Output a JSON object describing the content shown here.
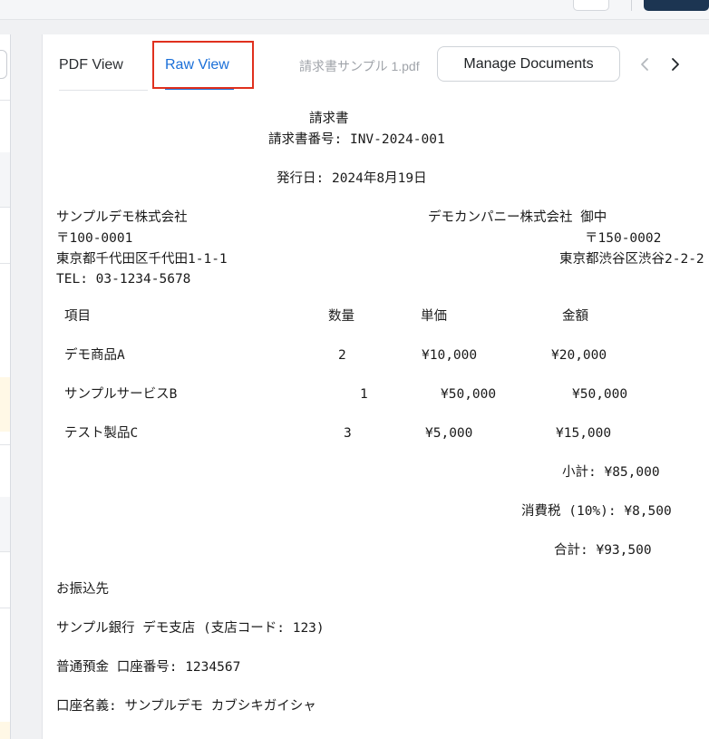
{
  "tabs": {
    "pdf_view": "PDF View",
    "raw_view": "Raw View"
  },
  "toolbar": {
    "filename": "請求書サンプル 1.pdf",
    "manage_documents": "Manage Documents"
  },
  "invoice": {
    "title": "請求書",
    "number_line": "請求書番号: INV-2024-001",
    "issue_date": "発行日: 2024年8月19日",
    "seller": {
      "name": "サンプルデモ株式会社",
      "postal": "〒100-0001",
      "address": "東京都千代田区千代田1-1-1",
      "tel": "TEL: 03-1234-5678"
    },
    "buyer": {
      "name": "デモカンパニー株式会社 御中",
      "postal": "〒150-0002",
      "address": "東京都渋谷区渋谷2-2-2"
    },
    "table": {
      "headers": {
        "item": "項目",
        "qty": "数量",
        "unit_price": "単価",
        "amount": "金額"
      },
      "rows": [
        {
          "item": "デモ商品A",
          "qty": "2",
          "unit_price": "¥10,000",
          "amount": "¥20,000"
        },
        {
          "item": "サンプルサービスB",
          "qty": "1",
          "unit_price": "¥50,000",
          "amount": "¥50,000"
        },
        {
          "item": "テスト製品C",
          "qty": "3",
          "unit_price": "¥5,000",
          "amount": "¥15,000"
        }
      ]
    },
    "subtotal": "小計: ¥85,000",
    "tax": "消費税 (10%): ¥8,500",
    "total": "合計: ¥93,500",
    "bank": {
      "heading": "お振込先",
      "bank_line": "サンプル銀行 デモ支店 (支店コード: 123)",
      "account_line": "普通預金 口座番号: 1234567",
      "holder_line": "口座名義: サンプルデモ カブシキガイシャ"
    }
  },
  "icons": {
    "prev": "chevron-left-icon",
    "next": "chevron-right-icon"
  }
}
